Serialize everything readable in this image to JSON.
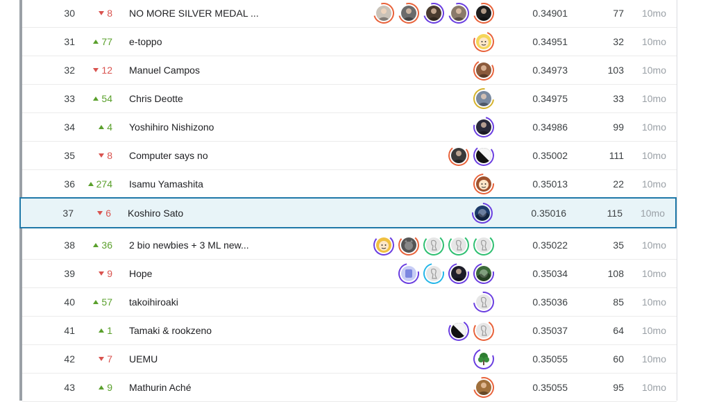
{
  "colors": {
    "up": "#5aa02c",
    "down": "#d9534f",
    "highlight_border": "#1f78a8",
    "highlight_bg": "#e8f4f8",
    "ring_orange": "#e8623a",
    "ring_purple": "#6a3ee0",
    "ring_green": "#2fbf71",
    "ring_cyan": "#25b6e8",
    "ring_gold": "#d4b22b"
  },
  "leaderboard": {
    "rows": [
      {
        "rank": "30",
        "direction": "down",
        "change": "8",
        "team": "NO MORE SILVER MEDAL ...",
        "score": "0.34901",
        "entries": "77",
        "last": "10mo",
        "avatars": [
          {
            "icon": "person-photo-icon",
            "ring": "orange",
            "bg": "#c9c2b8"
          },
          {
            "icon": "person-photo-icon",
            "ring": "orange",
            "bg": "#6b6b6b"
          },
          {
            "icon": "person-photo-icon",
            "ring": "purple",
            "bg": "#4a3b2f"
          },
          {
            "icon": "person-photo-icon",
            "ring": "purple",
            "bg": "#8a7a6a"
          },
          {
            "icon": "person-photo-icon",
            "ring": "orange",
            "bg": "#1e1e1e"
          }
        ]
      },
      {
        "rank": "31",
        "direction": "up",
        "change": "77",
        "team": "e-toppo",
        "score": "0.34951",
        "entries": "32",
        "last": "10mo",
        "avatars": [
          {
            "icon": "cartoon-face-icon",
            "ring": "orange",
            "bg": "#f5d65a"
          }
        ]
      },
      {
        "rank": "32",
        "direction": "down",
        "change": "12",
        "team": "Manuel Campos",
        "score": "0.34973",
        "entries": "103",
        "last": "10mo",
        "avatars": [
          {
            "icon": "person-photo-icon",
            "ring": "orange",
            "bg": "#8b5a3c"
          }
        ]
      },
      {
        "rank": "33",
        "direction": "up",
        "change": "54",
        "team": "Chris Deotte",
        "score": "0.34975",
        "entries": "33",
        "last": "10mo",
        "avatars": [
          {
            "icon": "person-photo-icon",
            "ring": "gold",
            "bg": "#7a8aa0"
          }
        ]
      },
      {
        "rank": "34",
        "direction": "up",
        "change": "4",
        "team": "Yoshihiro Nishizono",
        "score": "0.34986",
        "entries": "99",
        "last": "10mo",
        "avatars": [
          {
            "icon": "person-photo-icon",
            "ring": "purple",
            "bg": "#2a2a3a"
          }
        ]
      },
      {
        "rank": "35",
        "direction": "down",
        "change": "8",
        "team": "Computer says no",
        "score": "0.35002",
        "entries": "111",
        "last": "10mo",
        "avatars": [
          {
            "icon": "person-photo-icon",
            "ring": "orange",
            "bg": "#3a3a3a"
          },
          {
            "icon": "abstract-icon",
            "ring": "purple",
            "bg": "#111111"
          }
        ]
      },
      {
        "rank": "36",
        "direction": "up",
        "change": "274",
        "team": "Isamu Yamashita",
        "score": "0.35013",
        "entries": "22",
        "last": "10mo",
        "avatars": [
          {
            "icon": "cartoon-face-icon",
            "ring": "orange",
            "bg": "#a0522d"
          }
        ]
      },
      {
        "rank": "37",
        "direction": "down",
        "change": "6",
        "team": "Koshiro Sato",
        "score": "0.35016",
        "entries": "115",
        "last": "10mo",
        "highlight": true,
        "avatars": [
          {
            "icon": "landscape-photo-icon",
            "ring": "purple",
            "bg": "#1c3a6a"
          }
        ]
      },
      {
        "rank": "38",
        "direction": "up",
        "change": "36",
        "team": "2 bio newbies + 3 ML new...",
        "score": "0.35022",
        "entries": "35",
        "last": "10mo",
        "avatars": [
          {
            "icon": "cartoon-face-icon",
            "ring": "purple",
            "bg": "#f0c040"
          },
          {
            "icon": "animal-photo-icon",
            "ring": "orange",
            "bg": "#555555"
          },
          {
            "icon": "default-avatar-icon",
            "ring": "green",
            "bg": "#e6e6e6"
          },
          {
            "icon": "default-avatar-icon",
            "ring": "green",
            "bg": "#e6e6e6"
          },
          {
            "icon": "default-avatar-icon",
            "ring": "green",
            "bg": "#e6e6e6"
          }
        ]
      },
      {
        "rank": "39",
        "direction": "down",
        "change": "9",
        "team": "Hope",
        "score": "0.35034",
        "entries": "108",
        "last": "10mo",
        "avatars": [
          {
            "icon": "logo-icon",
            "ring": "purple",
            "bg": "#c8cdf5"
          },
          {
            "icon": "default-avatar-icon",
            "ring": "cyan",
            "bg": "#e6e6e6"
          },
          {
            "icon": "person-photo-icon",
            "ring": "purple",
            "bg": "#1d1d2a"
          },
          {
            "icon": "landscape-photo-icon",
            "ring": "purple",
            "bg": "#3c6a3a"
          }
        ]
      },
      {
        "rank": "40",
        "direction": "up",
        "change": "57",
        "team": "takoihiroaki",
        "score": "0.35036",
        "entries": "85",
        "last": "10mo",
        "avatars": [
          {
            "icon": "default-avatar-icon",
            "ring": "purple",
            "bg": "#e6e6e6"
          }
        ]
      },
      {
        "rank": "41",
        "direction": "up",
        "change": "1",
        "team": "Tamaki & rookzeno",
        "score": "0.35037",
        "entries": "64",
        "last": "10mo",
        "avatars": [
          {
            "icon": "abstract-icon",
            "ring": "purple",
            "bg": "#111111"
          },
          {
            "icon": "default-avatar-icon",
            "ring": "orange",
            "bg": "#e6e6e6"
          }
        ]
      },
      {
        "rank": "42",
        "direction": "down",
        "change": "7",
        "team": "UEMU",
        "score": "0.35055",
        "entries": "60",
        "last": "10mo",
        "avatars": [
          {
            "icon": "tree-icon",
            "ring": "purple",
            "bg": "#ffffff"
          }
        ]
      },
      {
        "rank": "43",
        "direction": "up",
        "change": "9",
        "team": "Mathurin Aché",
        "score": "0.35055",
        "entries": "95",
        "last": "10mo",
        "avatars": [
          {
            "icon": "person-photo-icon",
            "ring": "orange",
            "bg": "#a0703c"
          }
        ]
      }
    ]
  }
}
